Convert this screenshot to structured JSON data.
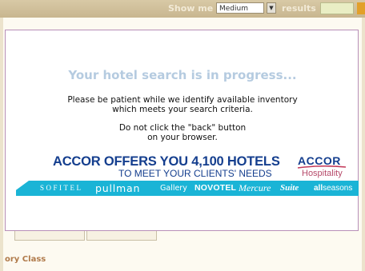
{
  "background": {
    "toolbar": {
      "show_me_label": "Show me",
      "page_size_value": "Medium",
      "results_label": "results"
    },
    "section_label": "ory Class"
  },
  "modal": {
    "title": "Your hotel search is in progress...",
    "message_line1": "Please be patient while we identify available inventory",
    "message_line2": "which meets your search criteria.",
    "warning_line1": "Do not click the \"back\" button",
    "warning_line2": "on your browser."
  },
  "banner": {
    "headline": "ACCOR OFFERS YOU 4,100 HOTELS",
    "subheadline": "TO MEET YOUR CLIENTS' NEEDS",
    "logo_text": "ACCOR",
    "logo_subtext": "Hospitality",
    "brands": {
      "sofitel": "SOFITEL",
      "pullman": "pullman",
      "gallery": "Gallery",
      "novotel": "NOVOTEL",
      "mercure": "Mercure",
      "suite": "Suite",
      "allseasons_bold": "all",
      "allseasons_rest": "seasons"
    },
    "colors": {
      "headline": "#143e8e",
      "strip": "#1ab4d6",
      "hospitality": "#b64a6a"
    }
  }
}
